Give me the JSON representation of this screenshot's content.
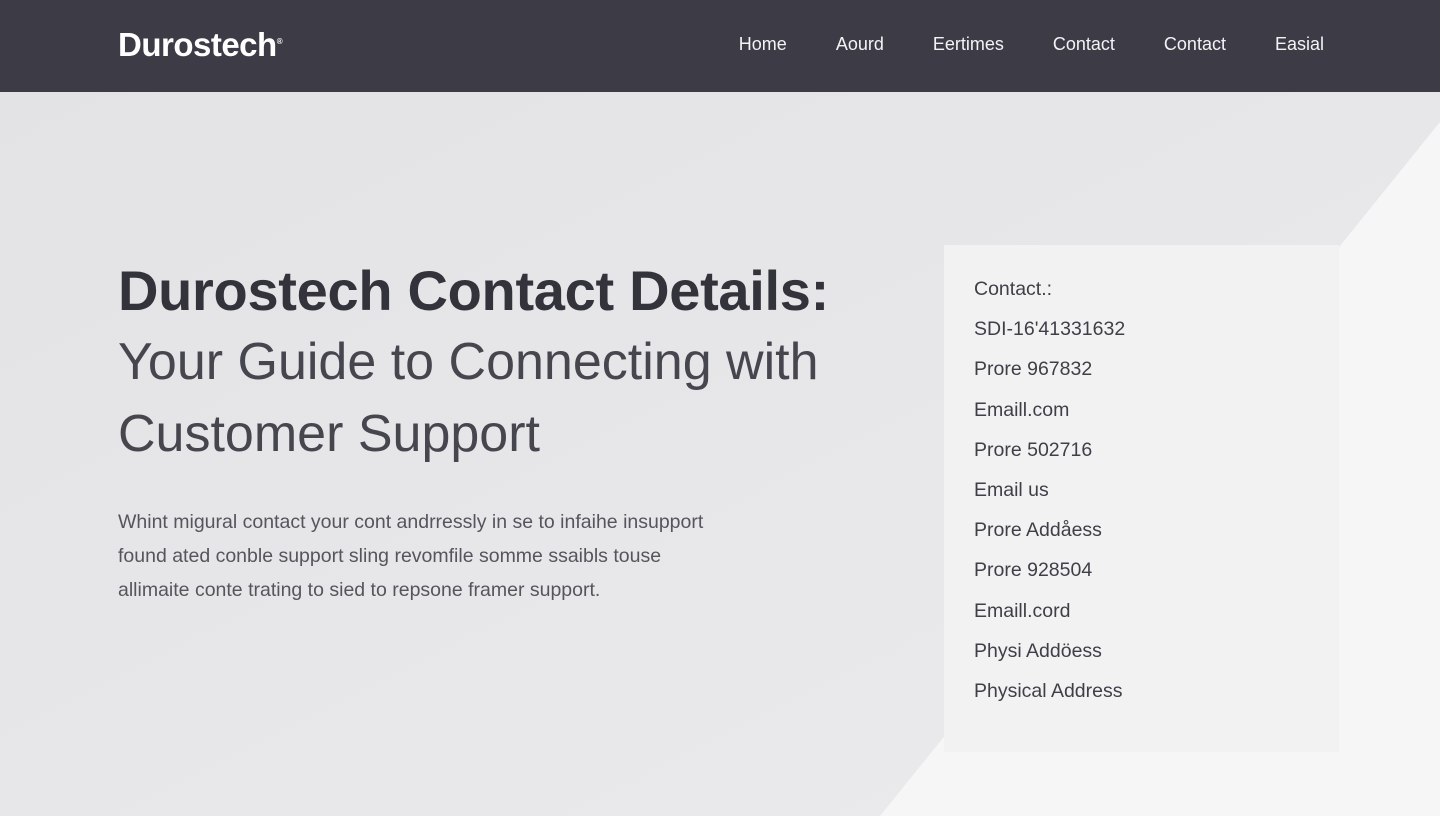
{
  "brand": {
    "name": "Durostech"
  },
  "nav": {
    "items": [
      {
        "label": "Home"
      },
      {
        "label": "Aourd"
      },
      {
        "label": "Eertimes"
      },
      {
        "label": "Contact"
      },
      {
        "label": "Contact"
      },
      {
        "label": "Easial"
      }
    ]
  },
  "hero": {
    "title_bold": "Durostech Contact Details:",
    "title_light_line1": "Your Guide to Connecting with",
    "title_light_line2": "Customer Support",
    "description_lines": [
      "Whint migural contact your cont andrressly in se to infaihe insupport",
      "found ated conble support sling revomfile somme ssaibls touse",
      "allimaite conte trating to sied to repsone framer support."
    ]
  },
  "contact_card": {
    "items": [
      {
        "text": "Contact.:"
      },
      {
        "text": "SDI-16'41331632"
      },
      {
        "text": "Prore 967832"
      },
      {
        "text": "Emaill.com"
      },
      {
        "text": "Prore 502716"
      },
      {
        "text": "Email us"
      },
      {
        "text": "Prore Addåess"
      },
      {
        "text": "Prore 928504"
      },
      {
        "text": "Emaill.cord"
      },
      {
        "text": "Physi Addöess"
      },
      {
        "text": "Physical Address"
      }
    ]
  },
  "colors": {
    "navbar_bg": "#3d3c46",
    "page_bg": "#e6e6e8",
    "card_bg": "#f2f2f3",
    "heading_text": "#33333b",
    "body_text": "#55555e",
    "nav_text": "#f3f3f5"
  }
}
